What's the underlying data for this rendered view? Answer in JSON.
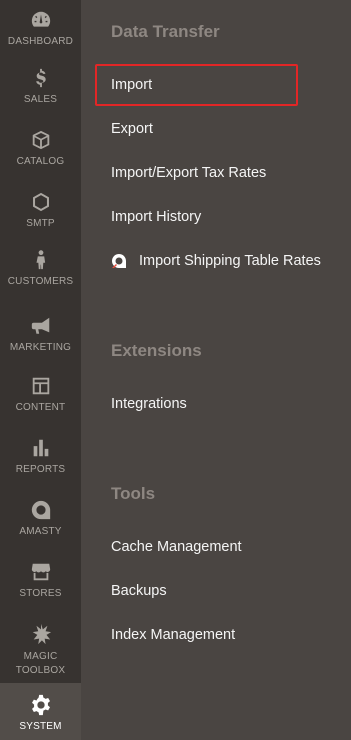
{
  "rail": {
    "items": [
      {
        "id": "dashboard",
        "label": "DASHBOARD",
        "icon": "dashboard-icon"
      },
      {
        "id": "sales",
        "label": "SALES",
        "icon": "dollar-icon"
      },
      {
        "id": "catalog",
        "label": "CATALOG",
        "icon": "box-icon"
      },
      {
        "id": "smtp",
        "label": "SMTP",
        "icon": "hexagon-icon"
      },
      {
        "id": "customers",
        "label": "CUSTOMERS",
        "icon": "person-icon"
      },
      {
        "id": "marketing",
        "label": "MARKETING",
        "icon": "megaphone-icon"
      },
      {
        "id": "content",
        "label": "CONTENT",
        "icon": "layout-icon"
      },
      {
        "id": "reports",
        "label": "REPORTS",
        "icon": "bar-chart-icon"
      },
      {
        "id": "amasty",
        "label": "AMASTY",
        "icon": "amasty-logo-icon"
      },
      {
        "id": "stores",
        "label": "STORES",
        "icon": "storefront-icon"
      },
      {
        "id": "magic_toolbox",
        "label_line1": "MAGIC",
        "label_line2": "TOOLBOX",
        "icon": "starburst-icon"
      },
      {
        "id": "system",
        "label": "SYSTEM",
        "icon": "gear-icon",
        "active": true
      }
    ]
  },
  "panel": {
    "data_transfer": {
      "title": "Data Transfer",
      "items": [
        "Import",
        "Export",
        "Import/Export Tax Rates",
        "Import History",
        "Import Shipping Table Rates"
      ]
    },
    "extensions": {
      "title": "Extensions",
      "items": [
        "Integrations"
      ]
    },
    "tools": {
      "title": "Tools",
      "items": [
        "Cache Management",
        "Backups",
        "Index Management"
      ]
    },
    "highlighted_item": "Import",
    "highlight_color": "#e22626"
  },
  "colors": {
    "rail_bg": "#373330",
    "rail_active_bg": "#524d49",
    "panel_bg": "#4a4542",
    "section_title": "#8e8782",
    "link": "#f5f5f5",
    "amasty_accent": "#e74c3c"
  }
}
